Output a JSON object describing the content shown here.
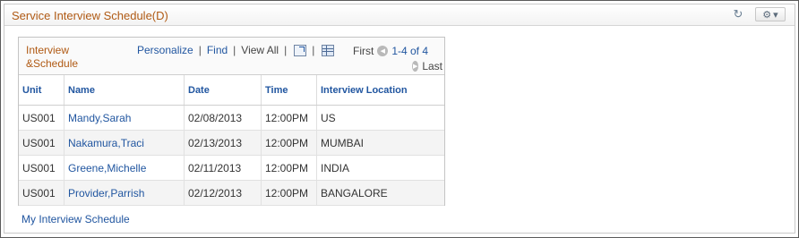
{
  "pagelet": {
    "title": "Service Interview Schedule(D)",
    "refresh_icon": "refresh-icon",
    "gear_icon": "gear-icon"
  },
  "grid": {
    "title_line1": "Interview",
    "title_line2": "&Schedule",
    "personalize": "Personalize",
    "find": "Find",
    "view_all": "View All",
    "zoom_icon": "zoom-icon",
    "download_icon": "spreadsheet-icon",
    "nav_first": "First",
    "nav_range": "1-4 of 4",
    "nav_last": "Last",
    "columns": [
      "Unit",
      "Name",
      "Date",
      "Time",
      "Interview Location"
    ],
    "rows": [
      {
        "unit": "US001",
        "name": "Mandy,Sarah",
        "date": "02/08/2013",
        "time": "12:00PM",
        "location": "US"
      },
      {
        "unit": "US001",
        "name": "Nakamura,Traci",
        "date": "02/13/2013",
        "time": "12:00PM",
        "location": "MUMBAI"
      },
      {
        "unit": "US001",
        "name": "Greene,Michelle",
        "date": "02/11/2013",
        "time": "12:00PM",
        "location": "INDIA"
      },
      {
        "unit": "US001",
        "name": "Provider,Parrish",
        "date": "02/12/2013",
        "time": "12:00PM",
        "location": "BANGALORE"
      }
    ]
  },
  "footer_link": "My Interview Schedule",
  "colors": {
    "title": "#b05a14",
    "link": "#2156a0",
    "border": "#c4c4c4"
  }
}
